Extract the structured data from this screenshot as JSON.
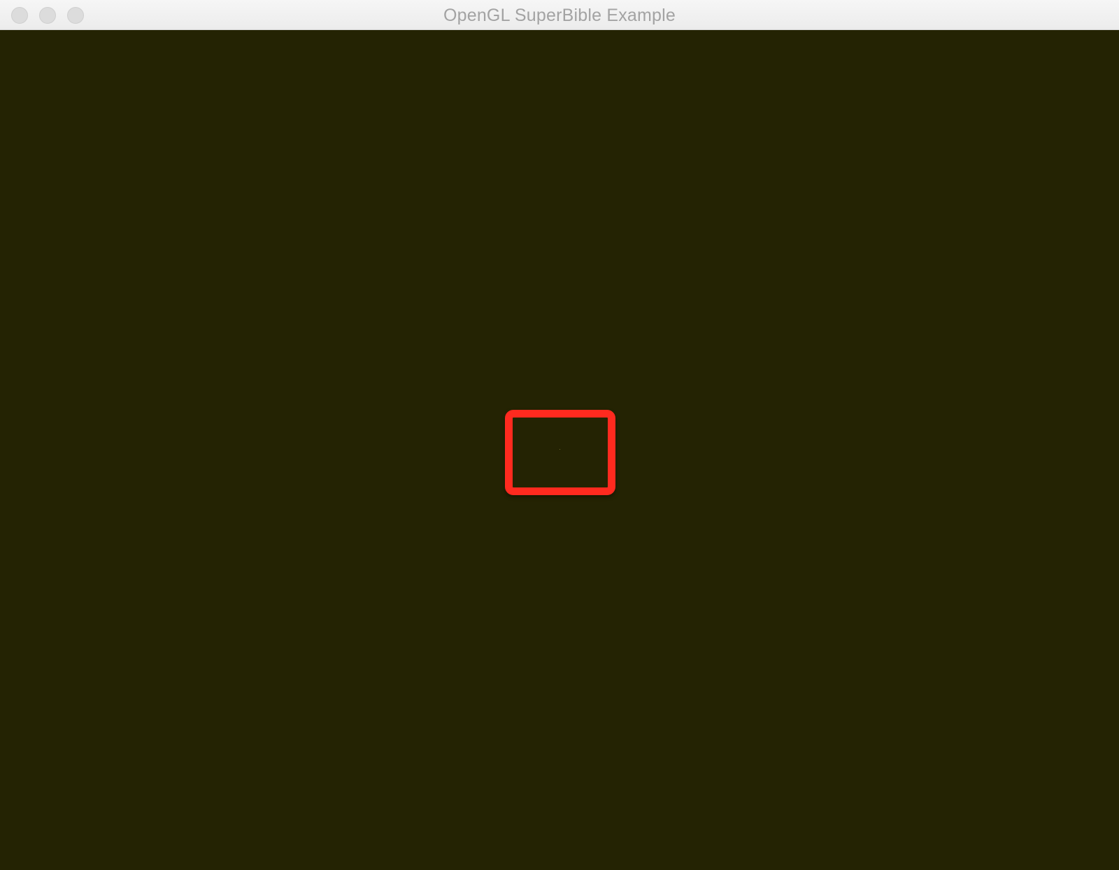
{
  "window": {
    "title": "OpenGL SuperBible Example"
  },
  "colors": {
    "clear_color": "#242303",
    "highlight": "#ff2a1f",
    "title_text": "#a3a3a3"
  },
  "icons": {
    "close": "close-icon",
    "minimize": "minimize-icon",
    "zoom": "zoom-icon"
  }
}
